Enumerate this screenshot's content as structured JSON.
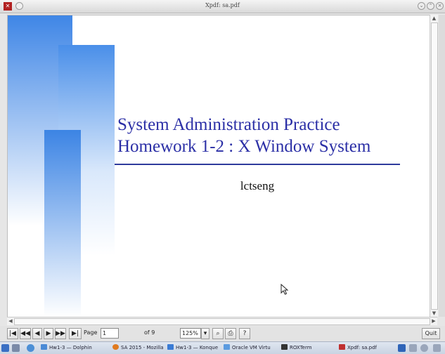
{
  "window": {
    "title": "Xpdf: sa.pdf"
  },
  "slide": {
    "title_line1": "System Administration Practice",
    "title_line2": "Homework 1-2 : X Window System",
    "author": "lctseng"
  },
  "toolbar": {
    "page_label": "Page",
    "page_value": "1",
    "of_label": "of 9",
    "zoom_value": "125%",
    "quit_label": "Quit",
    "help_label": "?"
  },
  "taskbar": {
    "tasks": [
      {
        "label": "Hw1-3 — Dolphin",
        "icon": "folder-icon"
      },
      {
        "label": "SA 2015 - Mozilla",
        "icon": "firefox-icon"
      },
      {
        "label": "Hw1-3 — Konque",
        "icon": "konqueror-icon"
      },
      {
        "label": "Oracle VM Virtu",
        "icon": "virtualbox-icon"
      },
      {
        "label": "ROXTerm",
        "icon": "terminal-icon"
      },
      {
        "label": "Xpdf: sa.pdf",
        "icon": "xpdf-icon"
      }
    ]
  },
  "colors": {
    "title_blue": "#2b2fa6",
    "deco_blue": "#3f86e6",
    "rule": "#2e3a9c"
  }
}
